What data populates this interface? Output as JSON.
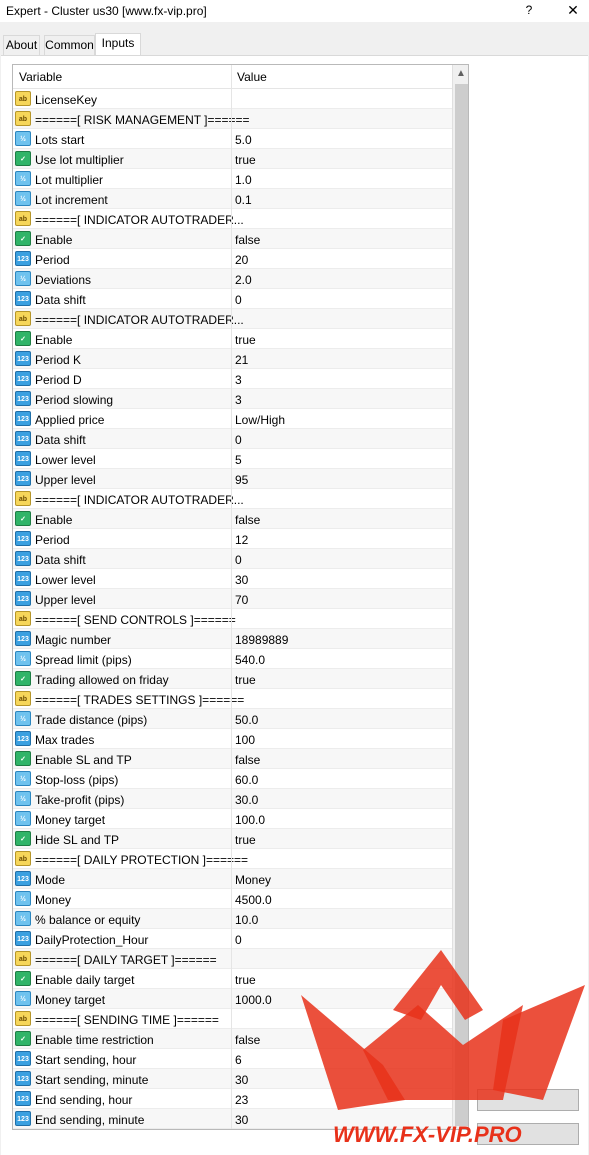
{
  "window": {
    "title": "Expert - Cluster us30 [www.fx-vip.pro]",
    "help_label": "?",
    "close_label": "✕"
  },
  "tabs": [
    {
      "label": "About",
      "active": false
    },
    {
      "label": "Common",
      "active": false
    },
    {
      "label": "Inputs",
      "active": true
    }
  ],
  "grid": {
    "columns": [
      "Variable",
      "Value"
    ],
    "rows": [
      {
        "type": "string",
        "variable": "LicenseKey",
        "value": ""
      },
      {
        "type": "string",
        "variable": "======[ RISK MANAGEMENT ]======",
        "value": ""
      },
      {
        "type": "double",
        "variable": "Lots start",
        "value": "5.0"
      },
      {
        "type": "bool",
        "variable": "Use lot multiplier",
        "value": "true"
      },
      {
        "type": "double",
        "variable": "Lot multiplier",
        "value": "1.0"
      },
      {
        "type": "double",
        "variable": "Lot increment",
        "value": "0.1"
      },
      {
        "type": "string",
        "variable": "======[ INDICATOR AUTOTRADER...",
        "value": ""
      },
      {
        "type": "bool",
        "variable": "Enable",
        "value": "false"
      },
      {
        "type": "int",
        "variable": "Period",
        "value": "20"
      },
      {
        "type": "double",
        "variable": "Deviations",
        "value": "2.0"
      },
      {
        "type": "int",
        "variable": "Data shift",
        "value": "0"
      },
      {
        "type": "string",
        "variable": "======[ INDICATOR AUTOTRADER...",
        "value": ""
      },
      {
        "type": "bool",
        "variable": "Enable",
        "value": "true"
      },
      {
        "type": "int",
        "variable": "Period K",
        "value": "21"
      },
      {
        "type": "int",
        "variable": "Period D",
        "value": "3"
      },
      {
        "type": "int",
        "variable": "Period slowing",
        "value": "3"
      },
      {
        "type": "int",
        "variable": "Applied price",
        "value": "Low/High"
      },
      {
        "type": "int",
        "variable": "Data shift",
        "value": "0"
      },
      {
        "type": "int",
        "variable": "Lower level",
        "value": "5"
      },
      {
        "type": "int",
        "variable": "Upper level",
        "value": "95"
      },
      {
        "type": "string",
        "variable": "======[ INDICATOR AUTOTRADER...",
        "value": ""
      },
      {
        "type": "bool",
        "variable": "Enable",
        "value": "false"
      },
      {
        "type": "int",
        "variable": "Period",
        "value": "12"
      },
      {
        "type": "int",
        "variable": "Data shift",
        "value": "0"
      },
      {
        "type": "int",
        "variable": "Lower level",
        "value": "30"
      },
      {
        "type": "int",
        "variable": "Upper level",
        "value": "70"
      },
      {
        "type": "string",
        "variable": "======[ SEND CONTROLS ]======",
        "value": ""
      },
      {
        "type": "int",
        "variable": "Magic number",
        "value": "18989889"
      },
      {
        "type": "double",
        "variable": "Spread limit (pips)",
        "value": "540.0"
      },
      {
        "type": "bool",
        "variable": "Trading allowed on friday",
        "value": "true"
      },
      {
        "type": "string",
        "variable": "======[ TRADES SETTINGS ]======",
        "value": ""
      },
      {
        "type": "double",
        "variable": "Trade distance (pips)",
        "value": "50.0"
      },
      {
        "type": "int",
        "variable": "Max trades",
        "value": "100"
      },
      {
        "type": "bool",
        "variable": "Enable SL and TP",
        "value": "false"
      },
      {
        "type": "double",
        "variable": "Stop-loss (pips)",
        "value": "60.0"
      },
      {
        "type": "double",
        "variable": "Take-profit (pips)",
        "value": "30.0"
      },
      {
        "type": "double",
        "variable": "Money target",
        "value": "100.0"
      },
      {
        "type": "bool",
        "variable": "Hide SL and TP",
        "value": "true"
      },
      {
        "type": "string",
        "variable": "======[ DAILY PROTECTION ]======",
        "value": ""
      },
      {
        "type": "int",
        "variable": "Mode",
        "value": "Money"
      },
      {
        "type": "double",
        "variable": "Money",
        "value": "4500.0"
      },
      {
        "type": "double",
        "variable": "% balance or equity",
        "value": "10.0"
      },
      {
        "type": "int",
        "variable": "DailyProtection_Hour",
        "value": "0"
      },
      {
        "type": "string",
        "variable": "======[ DAILY TARGET ]======",
        "value": ""
      },
      {
        "type": "bool",
        "variable": "Enable daily target",
        "value": "true"
      },
      {
        "type": "double",
        "variable": "Money target",
        "value": "1000.0"
      },
      {
        "type": "string",
        "variable": "======[ SENDING TIME ]======",
        "value": ""
      },
      {
        "type": "bool",
        "variable": "Enable time restriction",
        "value": "false"
      },
      {
        "type": "int",
        "variable": "Start sending, hour",
        "value": "6"
      },
      {
        "type": "int",
        "variable": "Start sending, minute",
        "value": "30"
      },
      {
        "type": "int",
        "variable": "End sending, hour",
        "value": "23"
      },
      {
        "type": "int",
        "variable": "End sending, minute",
        "value": "30"
      }
    ]
  },
  "icons": {
    "string": {
      "name": "string-type-icon",
      "glyph": "ab"
    },
    "int": {
      "name": "integer-type-icon",
      "glyph": "123"
    },
    "double": {
      "name": "double-type-icon",
      "glyph": "½"
    },
    "bool": {
      "name": "bool-type-icon",
      "glyph": "✓"
    }
  },
  "watermark": {
    "text": "WWW.FX-VIP.PRO",
    "color": "#e8311a"
  },
  "colors": {
    "title_bar": "#ffffff",
    "window_bg": "#f0f0f0",
    "watermark_red": "#e8311a"
  }
}
